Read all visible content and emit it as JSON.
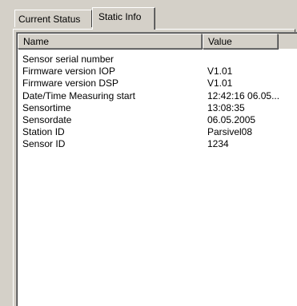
{
  "tabs": [
    {
      "label": "Current Status"
    },
    {
      "label": "Static Info"
    }
  ],
  "list": {
    "columns": [
      {
        "label": "Name"
      },
      {
        "label": "Value"
      }
    ],
    "rows": [
      {
        "name": "Sensor serial number",
        "value": ""
      },
      {
        "name": "Firmware version IOP",
        "value": "V1.01"
      },
      {
        "name": "Firmware version DSP",
        "value": "V1.01"
      },
      {
        "name": "Date/Time Measuring start",
        "value": "12:42:16 06.05..."
      },
      {
        "name": "Sensortime",
        "value": "13:08:35"
      },
      {
        "name": "Sensordate",
        "value": "06.05.2005"
      },
      {
        "name": "Station ID",
        "value": "Parsivel08"
      },
      {
        "name": "Sensor ID",
        "value": "1234"
      }
    ]
  }
}
